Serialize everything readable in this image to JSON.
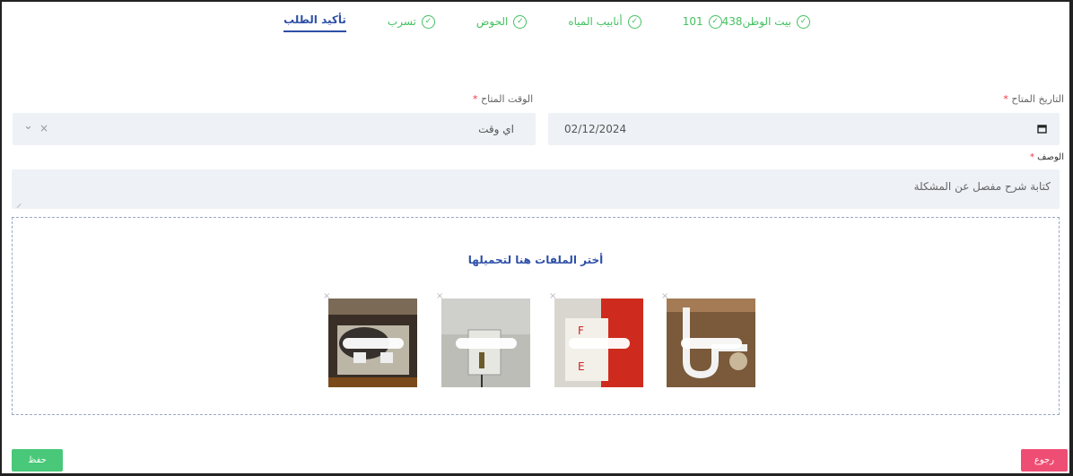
{
  "steps": [
    {
      "label": "بيت الوطن438",
      "done": true
    },
    {
      "label": "101",
      "done": true
    },
    {
      "label": "أنابيب المياه",
      "done": true
    },
    {
      "label": "الحوض",
      "done": true
    },
    {
      "label": "تسرب",
      "done": true
    },
    {
      "label": "تأكيد الطلب",
      "done": false
    }
  ],
  "form": {
    "date_label": "التاريخ المتاح",
    "time_label": "الوقت المتاح",
    "required_mark": "*",
    "date_value": "02/12/2024",
    "time_value": "اي وقت",
    "desc_label": "الوصف",
    "desc_placeholder": "كتابة شرح مفصل عن المشكلة"
  },
  "upload": {
    "title": "أختر الملفات هنا لتحميلها",
    "remove_glyph": "×"
  },
  "buttons": {
    "save": "حفظ",
    "back": "رجوع"
  },
  "icons": {
    "check": "✓",
    "calendar": "calendar-icon",
    "clear": "×",
    "chevron": "⌄"
  },
  "colors": {
    "accent_green": "#43c160",
    "accent_blue": "#2d4fa6",
    "back_red": "#ef4e74",
    "save_green": "#48c878"
  }
}
